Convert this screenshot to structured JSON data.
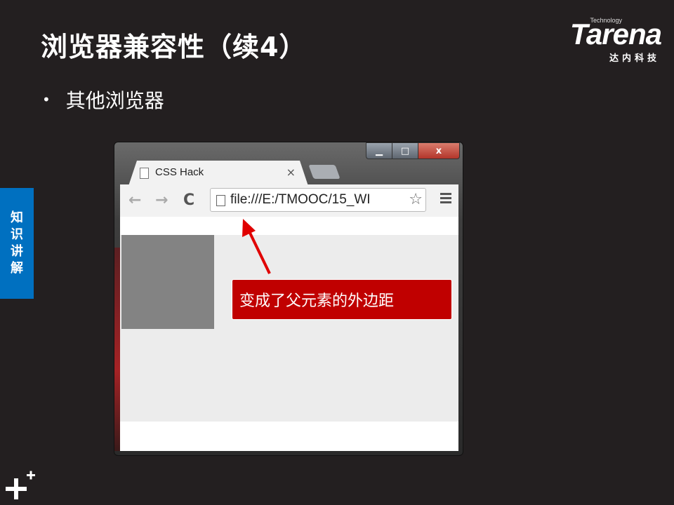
{
  "slide": {
    "title": "浏览器兼容性（续4）",
    "bullet": "其他浏览器",
    "side_tab": [
      "知",
      "识",
      "讲",
      "解"
    ]
  },
  "logo": {
    "tagline": "Technology",
    "brand": "Tarena",
    "cn": "达内科技"
  },
  "browser": {
    "tab_title": "CSS Hack",
    "tab_close": "×",
    "address": "file:///E:/TMOOC/15_WI",
    "controls": {
      "min": "▁",
      "max": "□",
      "close": "x"
    },
    "nav": {
      "back": "←",
      "forward": "→",
      "reload": "C"
    }
  },
  "callout": {
    "text": "变成了父元素的外边距"
  },
  "colors": {
    "background": "#231f20",
    "side_tab": "#0070c0",
    "callout": "#c00000",
    "arrow": "#e00000",
    "box": "#838383"
  }
}
